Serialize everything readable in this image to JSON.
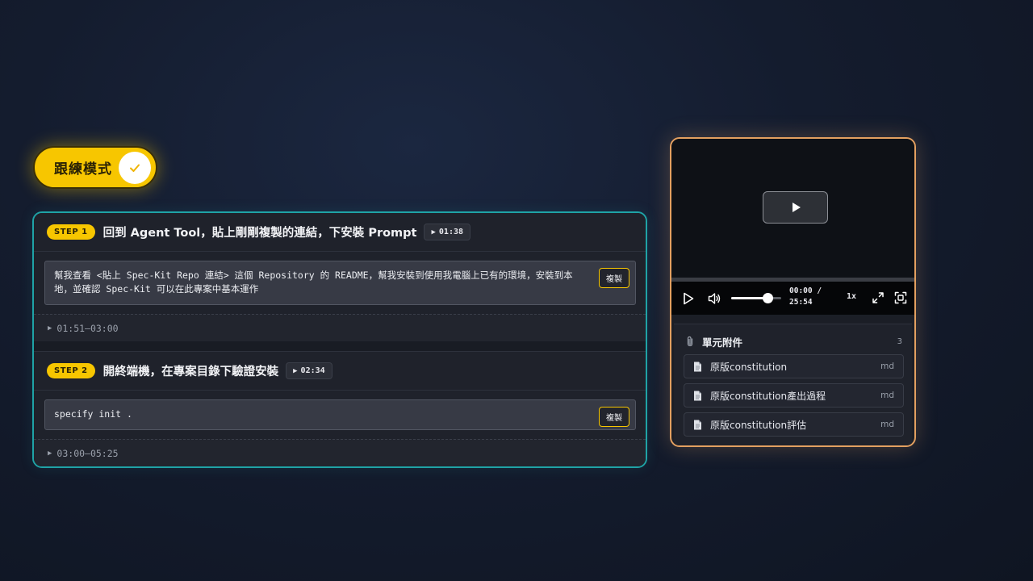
{
  "mode_toggle": {
    "label": "跟練模式",
    "checked": true
  },
  "steps": [
    {
      "badge": "STEP 1",
      "title": "回到 Agent Tool，貼上剛剛複製的連結，下安裝 Prompt",
      "time": "01:38",
      "prompt": "幫我查看 <貼上 Spec-Kit Repo 連結> 這個 Repository 的 README，幫我安裝到使用我電腦上已有的環境，安裝到本地，並確認 Spec-Kit 可以在此專案中基本運作",
      "copy_label": "複製",
      "range": "01:51–03:00"
    },
    {
      "badge": "STEP 2",
      "title": "開終端機，在專案目錄下驗證安裝",
      "time": "02:34",
      "prompt": "specify init .",
      "copy_label": "複製",
      "range": "03:00–05:25"
    }
  ],
  "video": {
    "current_time": "00:00 /",
    "duration": "25:54",
    "speed": "1x",
    "volume": 0.73,
    "progress": 0
  },
  "attachments": {
    "title": "單元附件",
    "count": "3",
    "items": [
      {
        "name": "原版constitution",
        "ext": "md"
      },
      {
        "name": "原版constitution產出過程",
        "ext": "md"
      },
      {
        "name": "原版constitution評估",
        "ext": "md"
      }
    ]
  },
  "colors": {
    "accent_yellow": "#f7c600",
    "teal_border": "#1fa3a6",
    "orange_border": "#e3a060"
  }
}
